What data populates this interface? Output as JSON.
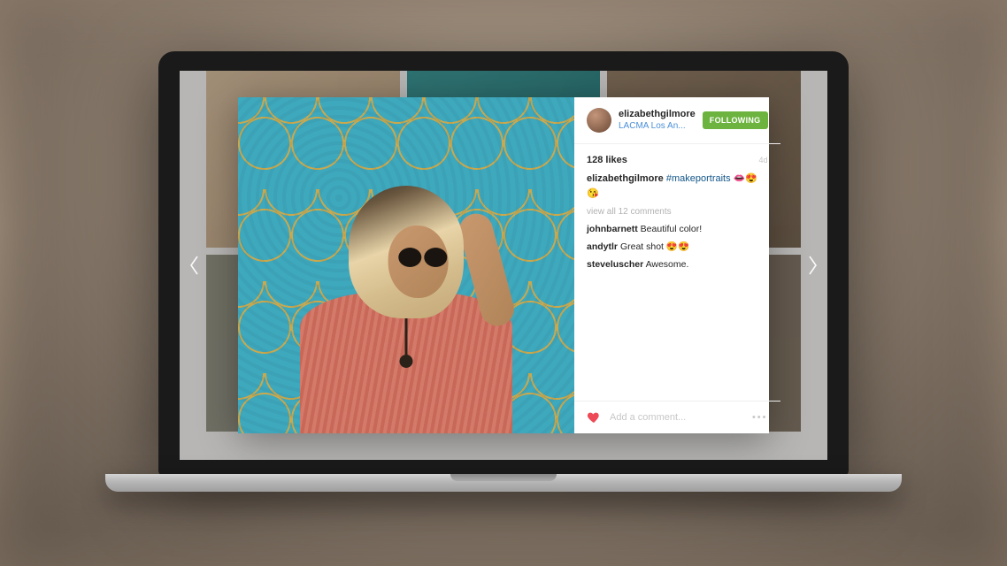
{
  "post": {
    "header": {
      "username": "elizabethgilmore",
      "location": "LACMA Los An...",
      "follow_button": "FOLLOWING"
    },
    "likes_count": "128 likes",
    "timestamp": "4d",
    "caption": {
      "username": "elizabethgilmore",
      "text": "#makeportraits 👄😍😘"
    },
    "view_all": "view all 12 comments",
    "comments": [
      {
        "username": "johnbarnett",
        "text": "Beautiful color!"
      },
      {
        "username": "andytlr",
        "text": "Great shot 😍😍"
      },
      {
        "username": "steveluscher",
        "text": "Awesome."
      }
    ],
    "footer": {
      "comment_placeholder": "Add a comment...",
      "more": "•••"
    }
  }
}
